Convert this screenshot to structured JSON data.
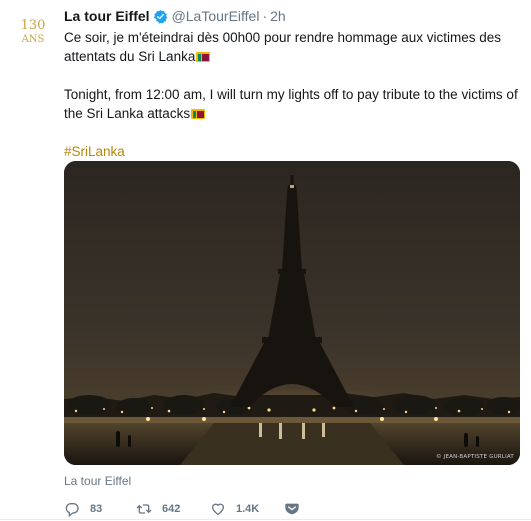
{
  "tweet": {
    "display_name": "La tour Eiffel",
    "handle": "@LaTourEiffel",
    "separator": "·",
    "timestamp": "2h",
    "text_fr": "Ce soir, je m'éteindrai dès 00h00 pour rendre hommage aux victimes des attentats du Sri Lanka",
    "text_en": "Tonight, from 12:00 am, I will turn my lights off to pay tribute to the victims of the Sri Lanka attacks",
    "hashtag": "#SriLanka",
    "media_caption": "La tour Eiffel",
    "photo_credit": "© JEAN-BAPTISTE GURLIAT",
    "avatar_logo": {
      "line1": "130",
      "line2": "ANS"
    },
    "flag_icon": "sri-lanka-flag",
    "reply_count": "83",
    "retweet_count": "642",
    "like_count": "1.4K"
  },
  "colors": {
    "link": "#b8860b",
    "verified": "#1da1f2",
    "muted": "#657786",
    "avatar_gold": "#c9a24a"
  }
}
